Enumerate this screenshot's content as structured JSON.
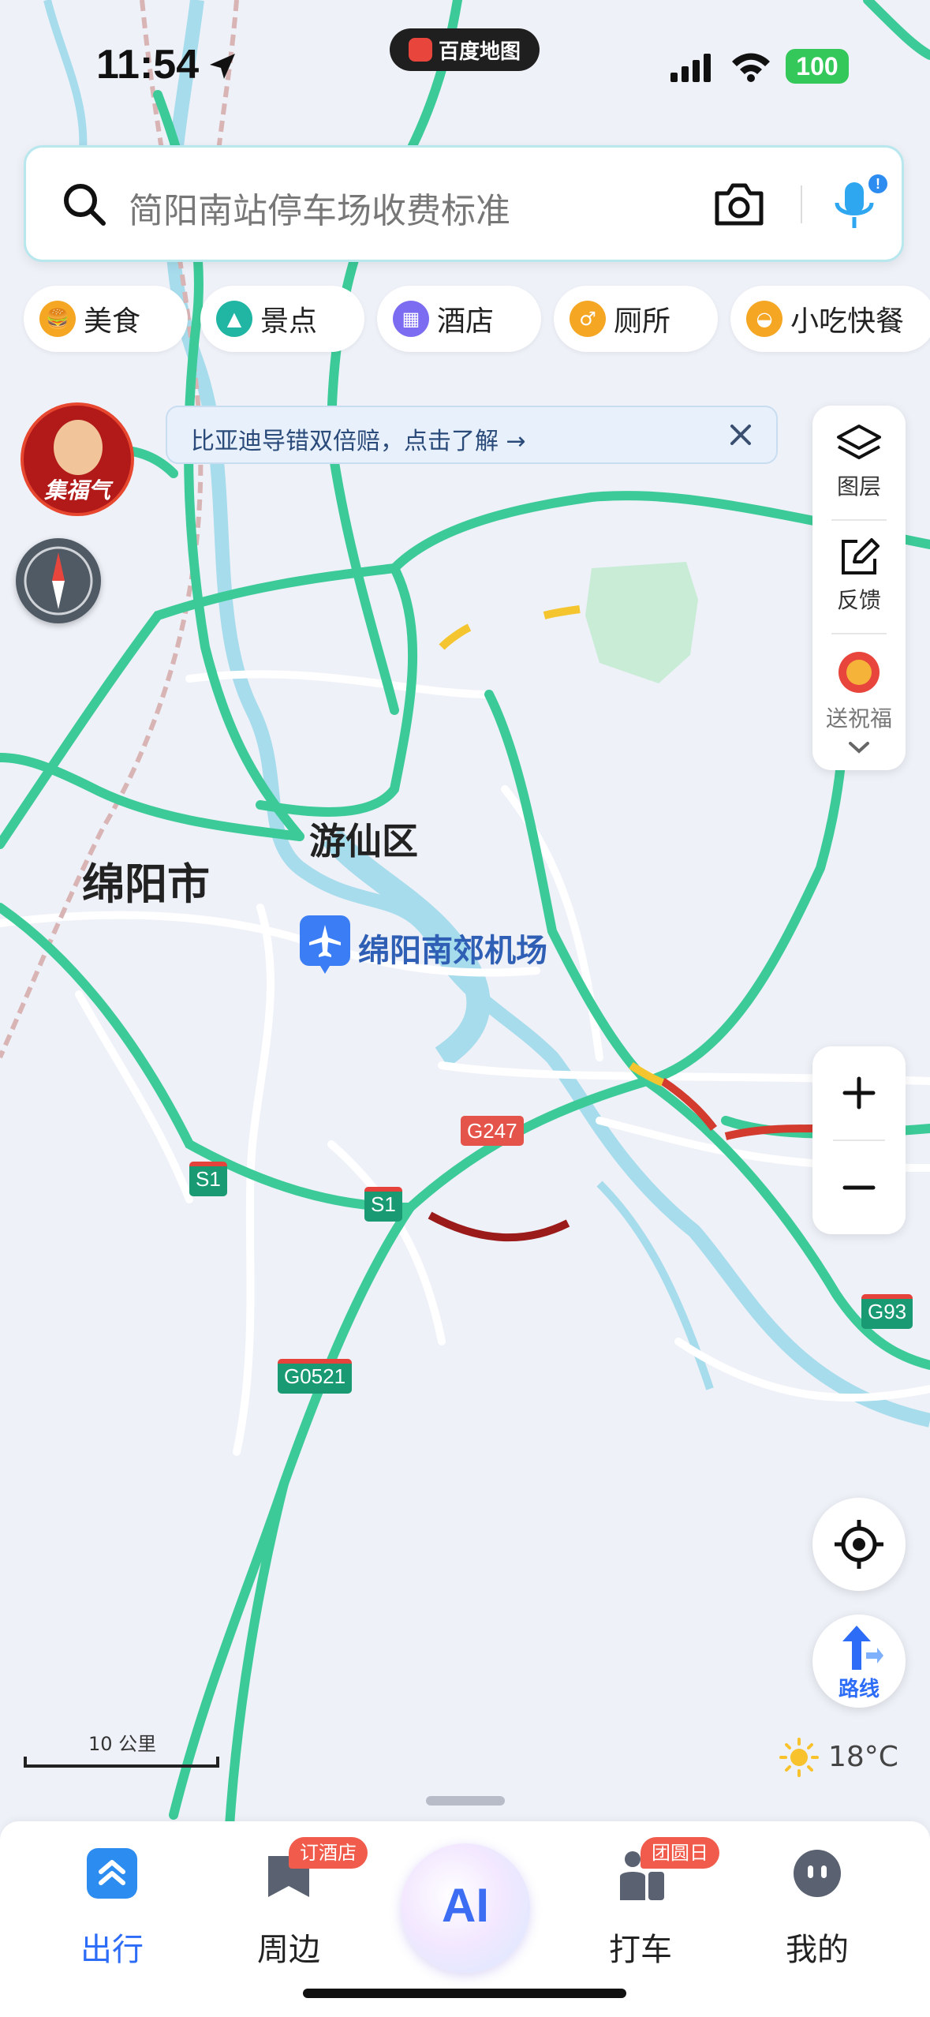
{
  "status_bar": {
    "time": "11:54",
    "app_name": "百度地图",
    "battery": "100"
  },
  "search": {
    "placeholder": "简阳南站停车场收费标准",
    "icons": [
      "search-icon",
      "camera-icon",
      "mic-icon"
    ]
  },
  "chips": [
    {
      "label": "美食",
      "icon": "food-icon",
      "color": "#f5a623"
    },
    {
      "label": "景点",
      "icon": "scenic-icon",
      "color": "#21b5a3"
    },
    {
      "label": "酒店",
      "icon": "hotel-icon",
      "color": "#7b6cf2"
    },
    {
      "label": "厕所",
      "icon": "toilet-icon",
      "color": "#f5a623"
    },
    {
      "label": "小吃快餐",
      "icon": "snack-icon",
      "color": "#f5a623"
    }
  ],
  "avatar": {
    "label": "集福气"
  },
  "banner": {
    "text": "比亚迪导错双倍赔，点击了解 →"
  },
  "toolbar": {
    "layers": "图层",
    "feedback": "反馈",
    "blessing": "送祝福"
  },
  "map": {
    "labels": {
      "city": "绵阳市",
      "district": "游仙区",
      "airport": "绵阳南郊机场"
    },
    "shields": {
      "g247": "G247",
      "s1a": "S1",
      "s1b": "S1",
      "g0521": "G0521",
      "g93": "G93"
    },
    "colors": {
      "highway": "#3ccb98",
      "road": "#ffffff",
      "water": "#a7dcec",
      "park": "#c9ecd7",
      "background": "#eef1f8",
      "congestion_red": "#d33b2f",
      "congestion_dark": "#9b1a1a",
      "slow_yellow": "#f4c52f"
    }
  },
  "scale": {
    "label": "10 公里"
  },
  "weather": {
    "temp": "18°C",
    "icon": "sun-icon"
  },
  "route_button": {
    "label": "路线"
  },
  "tabs": [
    {
      "label": "出行",
      "icon": "travel-icon",
      "active": true
    },
    {
      "label": "周边",
      "icon": "nearby-icon",
      "badge": "订酒店"
    },
    {
      "label": "AI",
      "icon": "ai-icon"
    },
    {
      "label": "打车",
      "icon": "taxi-icon",
      "badge": "团圆日"
    },
    {
      "label": "我的",
      "icon": "profile-icon"
    }
  ]
}
